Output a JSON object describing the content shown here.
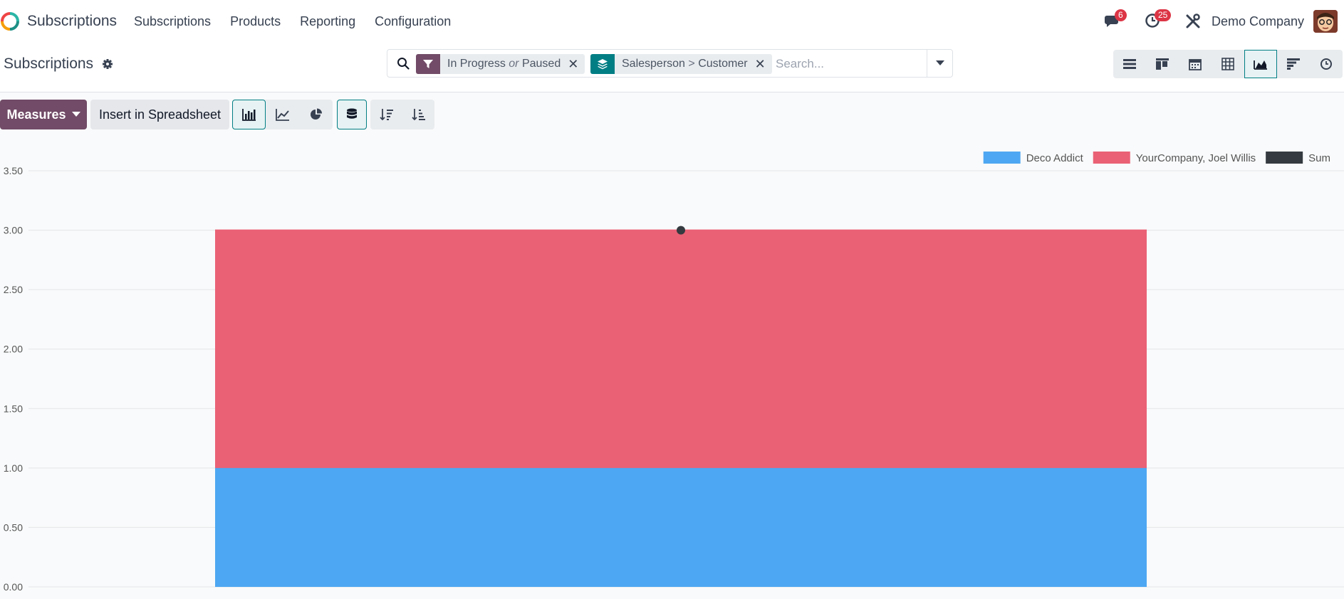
{
  "app": {
    "name": "Subscriptions"
  },
  "nav": {
    "items": [
      "Subscriptions",
      "Products",
      "Reporting",
      "Configuration"
    ]
  },
  "systray": {
    "messages_count": "6",
    "activities_count": "25",
    "company": "Demo Company"
  },
  "control_panel": {
    "breadcrumb": "Subscriptions",
    "facets": [
      {
        "type": "filter",
        "part1": "In Progress",
        "sep": "or",
        "part2": "Paused"
      },
      {
        "type": "groupby",
        "part1": "Salesperson",
        "sep": ">",
        "part2": "Customer"
      }
    ],
    "search_placeholder": "Search...",
    "views": [
      "list-view-icon",
      "kanban-view-icon",
      "calendar-view-icon",
      "pivot-view-icon",
      "graph-view-icon",
      "cohort-view-icon",
      "activity-view-icon"
    ],
    "active_view": "graph-view-icon"
  },
  "toolbar": {
    "measures_label": "Measures",
    "spreadsheet_label": "Insert in Spreadsheet"
  },
  "colors": {
    "brand": "#714b67",
    "accent": "#017e84",
    "deco": "#4ea7f2",
    "joel": "#ea6175",
    "sum": "#343a40"
  },
  "chart_data": {
    "type": "area",
    "stacked": true,
    "categories": [
      ""
    ],
    "series": [
      {
        "name": "Deco Addict",
        "values": [
          1
        ],
        "color": "#4ea7f2"
      },
      {
        "name": "YourCompany, Joel Willis",
        "values": [
          2
        ],
        "color": "#ea6175"
      },
      {
        "name": "Sum",
        "values": [
          3
        ],
        "color": "#343a40"
      }
    ],
    "yticks": [
      "0.00",
      "0.50",
      "1.00",
      "1.50",
      "2.00",
      "2.50",
      "3.00",
      "3.50"
    ],
    "ylim": [
      0,
      3.5
    ],
    "grid": true,
    "legend": "top-right"
  }
}
